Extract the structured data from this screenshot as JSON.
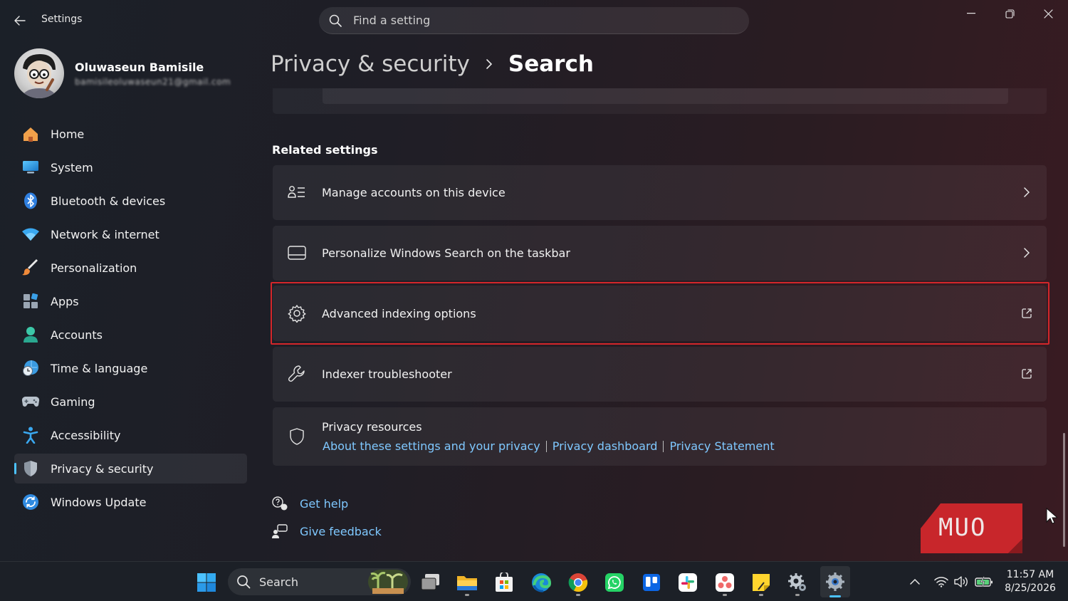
{
  "window": {
    "title": "Settings",
    "search_placeholder": "Find a setting"
  },
  "profile": {
    "name": "Oluwaseun Bamisile",
    "email": "bamisileoluwaseun21@gmail.com"
  },
  "sidebar": {
    "items": [
      {
        "label": "Home",
        "icon": "home-icon"
      },
      {
        "label": "System",
        "icon": "system-icon"
      },
      {
        "label": "Bluetooth & devices",
        "icon": "bluetooth-icon"
      },
      {
        "label": "Network & internet",
        "icon": "wifi-icon"
      },
      {
        "label": "Personalization",
        "icon": "brush-icon"
      },
      {
        "label": "Apps",
        "icon": "apps-icon"
      },
      {
        "label": "Accounts",
        "icon": "person-icon"
      },
      {
        "label": "Time & language",
        "icon": "clock-globe-icon"
      },
      {
        "label": "Gaming",
        "icon": "gamepad-icon"
      },
      {
        "label": "Accessibility",
        "icon": "accessibility-icon"
      },
      {
        "label": "Privacy & security",
        "icon": "shield-icon",
        "active": true
      },
      {
        "label": "Windows Update",
        "icon": "update-icon"
      }
    ]
  },
  "breadcrumb": {
    "parent": "Privacy & security",
    "current": "Search"
  },
  "related_settings": {
    "title": "Related settings",
    "items": [
      {
        "label": "Manage accounts on this device",
        "icon": "accounts-list-icon",
        "trail": "chevron-right-icon"
      },
      {
        "label": "Personalize Windows Search on the taskbar",
        "icon": "taskbar-icon",
        "trail": "chevron-right-icon"
      },
      {
        "label": "Advanced indexing options",
        "icon": "gear-icon",
        "trail": "external-link-icon",
        "highlighted": true
      },
      {
        "label": "Indexer troubleshooter",
        "icon": "wrench-icon",
        "trail": "external-link-icon"
      }
    ],
    "privacy_resources": {
      "title": "Privacy resources",
      "links": [
        "About these settings and your privacy",
        "Privacy dashboard",
        "Privacy Statement"
      ]
    }
  },
  "help": {
    "get_help": "Get help",
    "give_feedback": "Give feedback"
  },
  "watermark": "MUO",
  "taskbar": {
    "search_label": "Search",
    "apps": [
      "start-icon",
      "task-view-icon",
      "file-explorer-icon",
      "store-icon",
      "edge-icon",
      "chrome-icon",
      "whatsapp-icon",
      "trello-icon",
      "slack-icon",
      "asana-icon",
      "sticky-notes-icon",
      "settings-alt-icon",
      "settings-icon"
    ],
    "time": "11:57 AM",
    "date": "8/25/2026"
  },
  "colors": {
    "accent": "#4cc2ff",
    "link": "#7fc8ff",
    "highlight_border": "#d3262a"
  }
}
